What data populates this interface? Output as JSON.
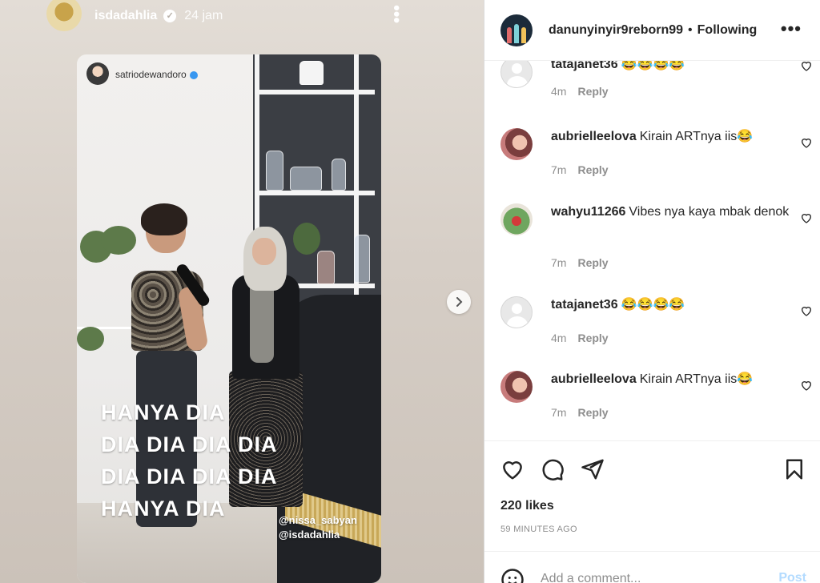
{
  "story": {
    "username": "isdadahlia",
    "time": "24 jam",
    "inner_username": "satriodewandoro",
    "lyrics": [
      "HANYA DIA",
      "DIA DIA DIA DIA",
      "DIA DIA DIA DIA",
      "HANYA DIA"
    ],
    "tags": [
      "@nissa_sabyan",
      "@isdadahlia"
    ]
  },
  "post": {
    "username": "danunyinyir9reborn99",
    "separator": "•",
    "follow_status": "Following",
    "more": "•••"
  },
  "comments": [
    {
      "user": "tatajanet36",
      "text": "😂😂😂😂",
      "time": "4m",
      "reply": "Reply",
      "avatar": "default-avatar"
    },
    {
      "user": "aubrielleelova",
      "text": "Kirain ARTnya iis😂",
      "time": "7m",
      "reply": "Reply",
      "avatar": "photo-avatar"
    },
    {
      "user": "wahyu11266",
      "text": "Vibes nya kaya mbak denok",
      "time": "7m",
      "reply": "Reply",
      "avatar": "photo-avatar"
    },
    {
      "user": "tatajanet36",
      "text": "😂😂😂😂",
      "time": "4m",
      "reply": "Reply",
      "avatar": "default-avatar"
    },
    {
      "user": "aubrielleelova",
      "text": "Kirain ARTnya iis😂",
      "time": "7m",
      "reply": "Reply",
      "avatar": "photo-avatar"
    }
  ],
  "actions": {
    "likes": "220 likes",
    "time_ago": "59 MINUTES AGO"
  },
  "comment_box": {
    "placeholder": "Add a comment...",
    "post_label": "Post"
  },
  "colors": {
    "text": "#262626",
    "muted": "#8e8e8e",
    "post_disabled": "#b3dbff",
    "verified": "#3897f0"
  }
}
